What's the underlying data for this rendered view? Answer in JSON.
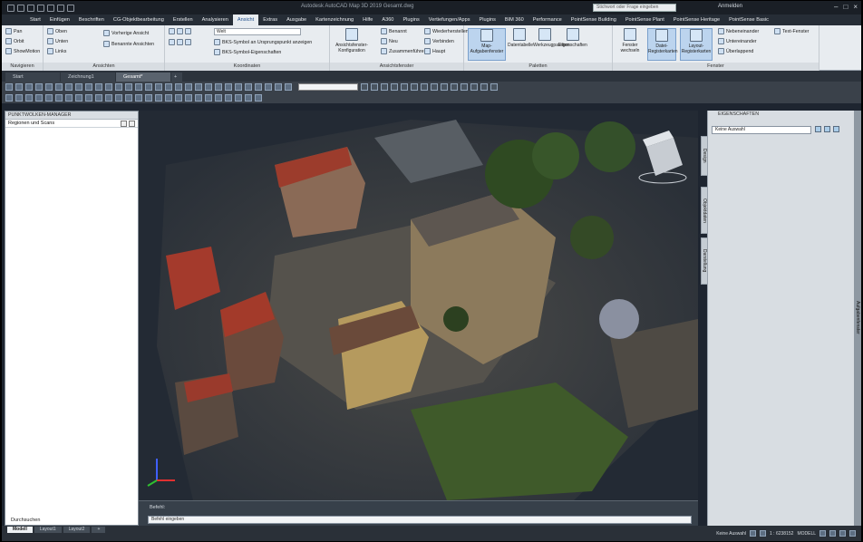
{
  "window": {
    "title": "Autodesk AutoCAD Map 3D 2019  Gesamt.dwg",
    "search_placeholder": "Stichwort oder Frage eingeben",
    "login_label": "Anmelden"
  },
  "ribbon_tabs": [
    "Start",
    "Einfügen",
    "Beschriften",
    "CG-Objektbearbeitung",
    "Erstellen",
    "Analysieren",
    "Ansicht",
    "Extras",
    "Ausgabe",
    "Kartenzeichnung",
    "Hilfe",
    "A360",
    "Plugins",
    "Vertiefungen/Apps",
    "Plugins",
    "BIM 360",
    "Performance",
    "PointSense Building",
    "PointSense Plant",
    "PointSense Heritage",
    "PointSense Basic"
  ],
  "active_tab": "Ansicht",
  "ribbon": {
    "navigieren": {
      "title": "Navigieren",
      "items": [
        "Pan",
        "Orbit",
        "ShowMotion"
      ]
    },
    "ansichten": {
      "title": "Ansichten",
      "items": [
        "Oben",
        "Unten",
        "Links"
      ],
      "extra": [
        "Vorherige Ansicht",
        "Benannte Ansichten"
      ]
    },
    "koordinaten": {
      "title": "Koordinaten",
      "items": [
        "Welt",
        "BKS-Symbol an Ursprungspunkt anzeigen",
        "BKS-Symbol-Eigenschaften"
      ]
    },
    "ansichtsfenster": {
      "title": "Ansichtsfenster",
      "items": [
        "Ansichtsfenster-Konfiguration",
        "Benannt",
        "Neu",
        "Verbinden",
        "Wiederherstellen",
        "Haupt",
        "Zusammenführen"
      ]
    },
    "paletten": {
      "title": "Paletten",
      "items": [
        "Map-Aufgabenfenster",
        "Datentabelle",
        "Werkzeugpaletten",
        "Eigenschaften"
      ]
    },
    "fenster": {
      "title": "Fenster",
      "items": [
        "Fenster wechseln",
        "Datei-Registerkarten",
        "Layout-Registerkarten",
        "Nebeneinander",
        "Untereinander",
        "Überlappend"
      ],
      "extra": "Text-Fenster"
    }
  },
  "doc_tabs": [
    "Start",
    "Zeichnung1",
    "Gesamt*",
    "+"
  ],
  "active_doc_tab": "Gesamt*",
  "left_pane": {
    "title": "PUNKTWOLKEN-MANAGER",
    "subtitle": "Regionen und Scans",
    "footer": "Durchsuchen"
  },
  "right_pane": {
    "title": "EIGENSCHAFTEN",
    "selection": "Keine Auswahl",
    "side_tabs": [
      "Design",
      "Objektdaten",
      "Darstellung"
    ],
    "edge_label": "Aufgabenfenster"
  },
  "command": {
    "history": "Befehl:",
    "prompt": "Befehl eingeben"
  },
  "layout_tabs": [
    "Modell",
    "Layout1",
    "Layout2",
    "+"
  ],
  "status": {
    "model": "MODELL",
    "scale": "1 : 6238152",
    "selection": "Keine Auswahl"
  },
  "colors": {
    "ribbon_bg": "#e8ecf0",
    "title_bg": "#1a1f26",
    "active_tab": "#1f4e8c",
    "viewport_bg": "#232a34"
  }
}
